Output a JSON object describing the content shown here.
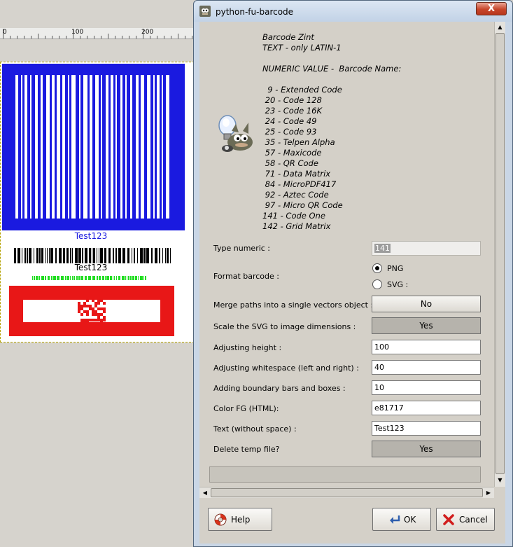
{
  "window": {
    "title": "python-fu-barcode",
    "close_label": "X"
  },
  "canvas": {
    "ruler_labels": [
      "0",
      "100",
      "200"
    ],
    "barcode_label_1": "Test123",
    "barcode_label_2": "Test123"
  },
  "description_lines": [
    "Barcode Zint",
    "TEXT - only LATIN-1",
    "",
    "NUMERIC VALUE -  Barcode Name:",
    "",
    "  9 - Extended Code",
    " 20 - Code 128",
    " 23 - Code 16K",
    " 24 - Code 49",
    " 25 - Code 93",
    " 35 - Telpen Alpha",
    " 57 - Maxicode",
    " 58 - QR Code",
    " 71 - Data Matrix",
    " 84 - MicroPDF417",
    " 92 - Aztec Code",
    " 97 - Micro QR Code",
    "141 - Code One",
    "142 - Grid Matrix"
  ],
  "form": {
    "type_numeric": {
      "label": "Type numeric :",
      "value": "141"
    },
    "format": {
      "label": "Format barcode :",
      "options": [
        "PNG",
        "SVG :"
      ],
      "selected": "PNG"
    },
    "merge_paths": {
      "label": "Merge paths into a single vectors object :",
      "value": "No"
    },
    "scale_svg": {
      "label": "Scale the SVG to image dimensions :",
      "value": "Yes"
    },
    "height": {
      "label": "Adjusting height :",
      "value": "100"
    },
    "whitespace": {
      "label": "Adjusting whitespace (left and right) :",
      "value": "40"
    },
    "boundary": {
      "label": "Adding boundary bars and boxes :",
      "value": "10"
    },
    "color_fg": {
      "label": "Color FG (HTML):",
      "value": "e81717"
    },
    "text": {
      "label": "Text (without space) :",
      "value": "Test123"
    },
    "delete_temp": {
      "label": "Delete temp file?",
      "value": "Yes"
    }
  },
  "buttons": {
    "help": "Help",
    "ok": "OK",
    "cancel": "Cancel"
  },
  "colors": {
    "barcode_blue": "#1a1ae0",
    "barcode_red": "#e81717",
    "barcode_green": "#22dd22"
  }
}
